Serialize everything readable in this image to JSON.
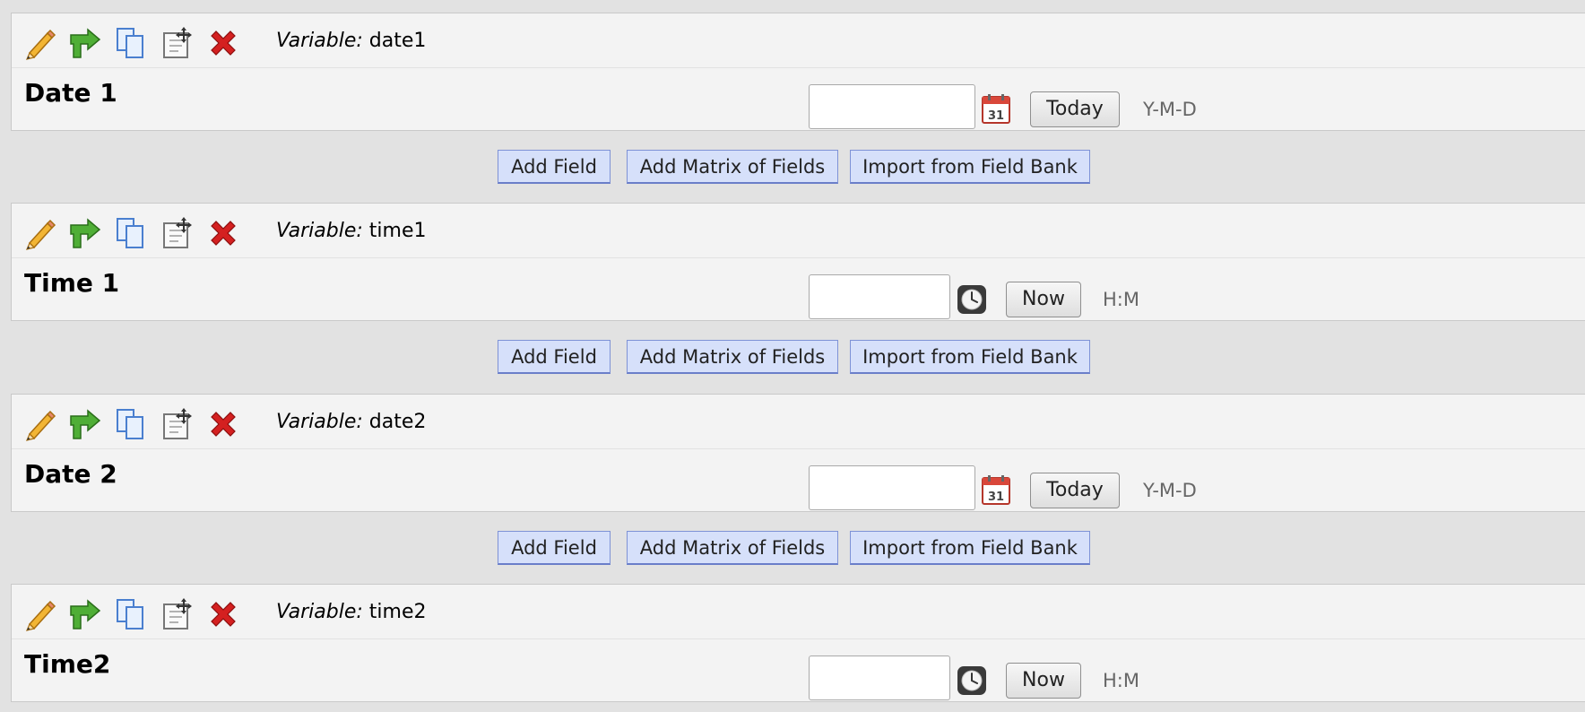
{
  "fields": [
    {
      "variable_label": "Variable:",
      "variable": "date1",
      "label": "Date 1",
      "button": "Today",
      "format": "Y-M-D"
    },
    {
      "variable_label": "Variable:",
      "variable": "time1",
      "label": "Time 1",
      "button": "Now",
      "format": "H:M"
    },
    {
      "variable_label": "Variable:",
      "variable": "date2",
      "label": "Date 2",
      "button": "Today",
      "format": "Y-M-D"
    },
    {
      "variable_label": "Variable:",
      "variable": "time2",
      "label": "Time2",
      "button": "Now",
      "format": "H:M"
    }
  ],
  "add_bar": {
    "add_field": "Add Field",
    "add_matrix": "Add Matrix of Fields",
    "import_bank": "Import from Field Bank"
  },
  "icons": {
    "toolbar": [
      "pencil-icon",
      "branch-arrow-icon",
      "copy-icon",
      "move-icon",
      "delete-icon"
    ],
    "date_picker": "calendar-icon",
    "time_picker": "clock-icon"
  },
  "colors": {
    "background": "#e2e2e2",
    "field_background": "#f3f3f3",
    "add_button": "#d6e0fa",
    "add_button_border": "#7e92d6",
    "delete_red": "#d42020",
    "branch_green": "#3f9a2a"
  }
}
